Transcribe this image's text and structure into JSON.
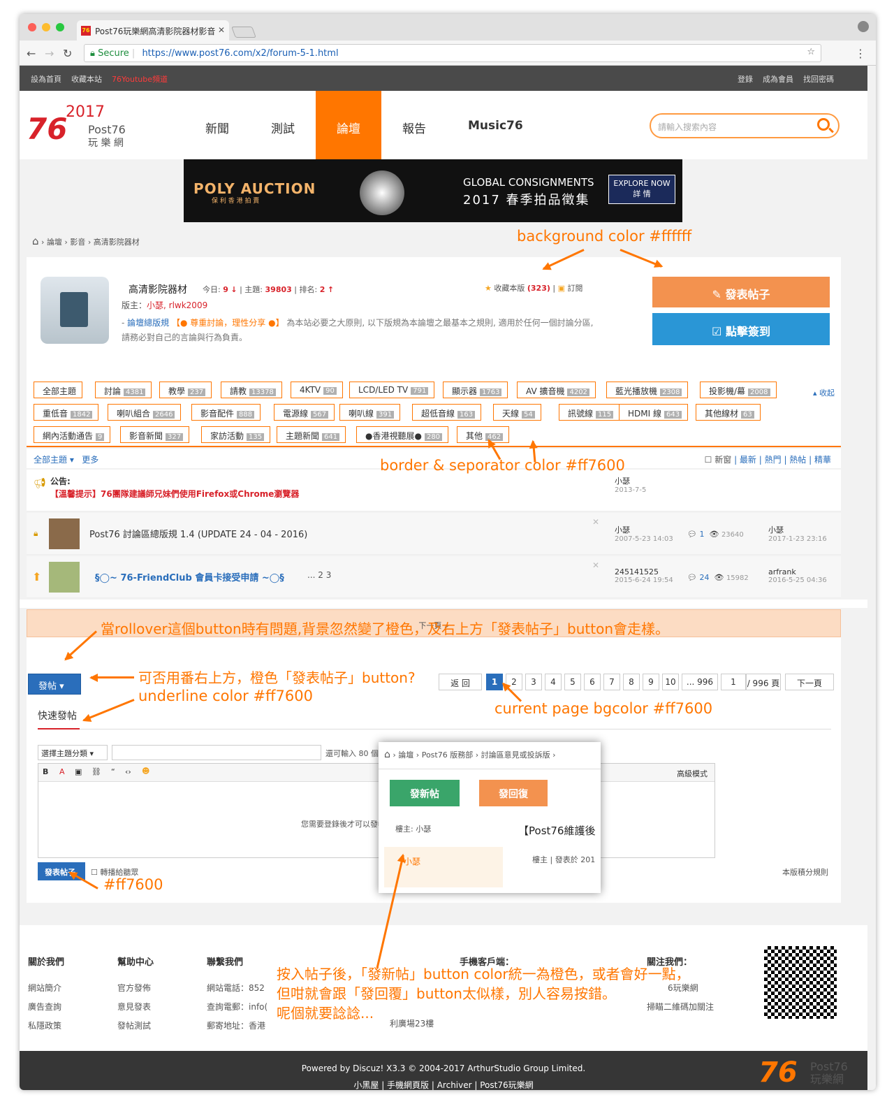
{
  "browser": {
    "tab_title": "Post76玩樂網高清影院器材影音",
    "secure_label": "Secure",
    "url": "https://www.post76.com/x2/forum-5-1.html"
  },
  "topbar": {
    "left": [
      "設為首頁",
      "收藏本站",
      "76Youtube頻道"
    ],
    "right": [
      "登錄",
      "成為會員",
      "找回密碼"
    ]
  },
  "header": {
    "logo_year": "2017",
    "logo_num": "76",
    "logo_text": "Post76",
    "logo_sub": "玩 樂 網",
    "nav": [
      "新聞",
      "測試",
      "論壇",
      "報告",
      "Music76"
    ],
    "active_nav": "論壇",
    "search_placeholder": "請輸入搜索內容"
  },
  "banner": {
    "brand": "POLY AUCTION",
    "brand_sub": "保 利 香 港 拍 賣",
    "line1": "GLOBAL CONSIGNMENTS",
    "line2": "2017 春季拍品徵集",
    "cta1": "EXPLORE NOW",
    "cta2": "詳 情"
  },
  "breadcrumb": [
    "論壇",
    "影音",
    "高清影院器材"
  ],
  "forum": {
    "title": "高清影院器材",
    "today_label": "今日:",
    "today": "9",
    "topics_label": "主題:",
    "topics": "39803",
    "rank_label": "排名:",
    "rank": "2",
    "fav_label": "收藏本版",
    "fav_count": "(323)",
    "subscribe": "訂閱",
    "mods_label": "版主：",
    "mods": "小瑟, rlwk2009",
    "rule_link": "論壇總版規",
    "rule_tag": "【● 尊重討論，理性分享 ●】",
    "rule_text": "為本站必要之大原則, 以下版規為本論壇之最基本之規則, 適用於任何一個討論分區, 請務必對自己的言論與行為負責。",
    "post_button": "發表帖子",
    "sign_button": "點擊簽到"
  },
  "tags": [
    {
      "label": "全部主題",
      "count": ""
    },
    {
      "label": "討論",
      "count": "4381"
    },
    {
      "label": "教學",
      "count": "237"
    },
    {
      "label": "請教",
      "count": "13378"
    },
    {
      "label": "4KTV",
      "count": "90"
    },
    {
      "label": "LCD/LED TV",
      "count": "791"
    },
    {
      "label": "顯示器",
      "count": "1763"
    },
    {
      "label": "AV 擴音機",
      "count": "4202"
    },
    {
      "label": "藍光播放機",
      "count": "2308"
    },
    {
      "label": "投影機/幕",
      "count": "2008"
    },
    {
      "label": "重低音",
      "count": "1842"
    },
    {
      "label": "喇叭組合",
      "count": "2646"
    },
    {
      "label": "影音配件",
      "count": "888"
    },
    {
      "label": "電源線",
      "count": "567"
    },
    {
      "label": "喇叭線",
      "count": "391"
    },
    {
      "label": "超低音線",
      "count": "163"
    },
    {
      "label": "天線",
      "count": "54"
    },
    {
      "label": "訊號線",
      "count": "115"
    },
    {
      "label": "HDMI 線",
      "count": "643"
    },
    {
      "label": "其他線材",
      "count": "63"
    },
    {
      "label": "網內活動通告",
      "count": "9"
    },
    {
      "label": "影音新聞",
      "count": "327"
    },
    {
      "label": "家訪活動",
      "count": "135"
    },
    {
      "label": "主題新聞",
      "count": "641"
    },
    {
      "label": "●香港視聽展●",
      "count": "280"
    },
    {
      "label": "其他",
      "count": "462"
    }
  ],
  "collapse": "收起",
  "threadbar": {
    "left": [
      "全部主題",
      "更多"
    ],
    "right": [
      "新窗",
      "最新",
      "熱門",
      "熱帖",
      "精華"
    ]
  },
  "notice": {
    "label": "公告:",
    "text": "【溫馨提示】76團隊建議師兄妹們使用Firefox或Chrome瀏覽器",
    "author": "小瑟",
    "date": "2013-7-5"
  },
  "threads": [
    {
      "title": "Post76 討論區總版規 1.4 (UPDATE 24 - 04 - 2016)",
      "author": "小瑟",
      "date": "2007-5-23 14:03",
      "replies": "1",
      "views": "23640",
      "last": "小瑟",
      "last_date": "2017-1-23 23:16",
      "pages": ""
    },
    {
      "title": "§◯~ 76-FriendClub 會員卡接受申請 ~◯§",
      "author": "245141525",
      "date": "2015-6-24 19:54",
      "replies": "24",
      "views": "15982",
      "last": "arfrank",
      "last_date": "2016-5-25 04:36",
      "pages": "... 2  3"
    }
  ],
  "next_page": "下一頁 »",
  "pager": {
    "new_post": "發帖",
    "back": "返 回",
    "pages": [
      "1",
      "2",
      "3",
      "4",
      "5",
      "6",
      "7",
      "8",
      "9",
      "10",
      "... 996"
    ],
    "page_input": "1",
    "total": "/ 996 頁",
    "next": "下一頁"
  },
  "quickpost": {
    "title": "快速發帖",
    "select": "選擇主題分類",
    "hint": "還可輸入 80 個字符",
    "toolbar_right": "高級模式",
    "editor_msg": "您需要登錄後才可以發帖",
    "submit": "發表帖子",
    "broadcast": "轉播給聽眾",
    "rules": "本版積分規則"
  },
  "popup": {
    "crumbs": [
      "論壇",
      "Post76 版務部",
      "討論區意見或投訴版"
    ],
    "new_button": "發新帖",
    "reply_button": "發回復",
    "owner": "樓主: 小瑟",
    "title": "【Post76維護後",
    "user": "小瑟",
    "floor": "樓主",
    "posted": "發表於 201"
  },
  "footer": {
    "about": {
      "title": "關於我們",
      "items": [
        "網站簡介",
        "廣告查詢",
        "私隱政策"
      ]
    },
    "help": {
      "title": "幫助中心",
      "items": [
        "官方發佈",
        "意見發表",
        "發帖測試"
      ]
    },
    "contact": {
      "title": "聯繫我們",
      "items": [
        "網站電話：852",
        "查詢電郵：info(",
        "郵寄地址：香港"
      ]
    },
    "mobile_title": "手機客戶端：",
    "follow_title": "關注我們：",
    "follow_items": [
      "6玩樂網",
      "掃瞄二維碼加關注"
    ],
    "address_tail": "利廣場23樓",
    "powered": "Powered by Discuz! X3.3 © 2004-2017 ArthurStudio Group Limited.",
    "links": "小黑屋 | 手機網頁版 | Archiver | Post76玩樂網"
  },
  "annotations": {
    "bg": "background color #ffffff",
    "border": "border & seporator color #ff7600",
    "rollover": "當rollover這個button時有問題,背景忽然變了橙色，及右上方「發表帖子」button會走樣。",
    "use_orange": "可否用番右上方，橙色「發表帖子」button?",
    "underline": "underline color #ff7600",
    "current": "current page bgcolor #ff7600",
    "submit_color": "#ff7600",
    "popup_note1": "按入帖子後，「發新帖」button color統一為橙色，或者會好一點，",
    "popup_note2": "但咁就會跟「發回覆」button太似樣，別人容易按錯。",
    "popup_note3": "呢個就要諗諗..."
  },
  "watermark": {
    "num": "76",
    "text": "Post76",
    "sub": "玩樂網"
  },
  "colors": {
    "accent": "#ff7600",
    "blue": "#2a6ebb",
    "post_btn": "#f3924f",
    "sign_btn": "#2a96d6",
    "new_btn": "#3aa56a"
  }
}
